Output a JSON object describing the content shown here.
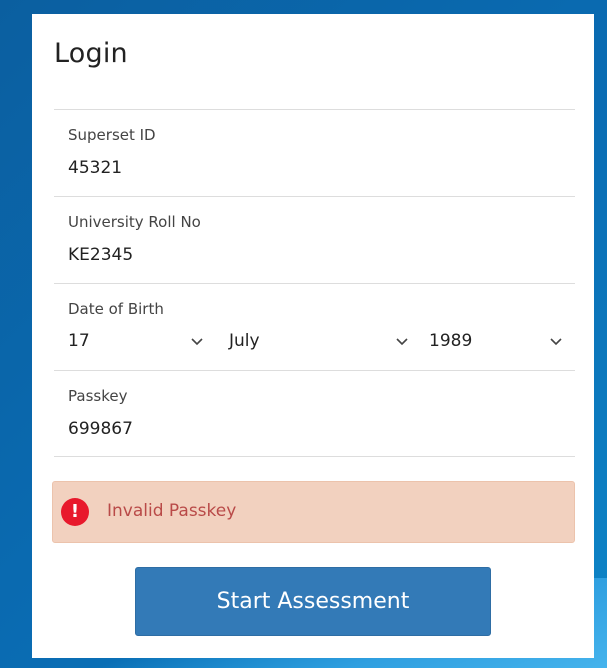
{
  "login": {
    "title": "Login",
    "fields": {
      "superset_id": {
        "label": "Superset ID",
        "value": "45321"
      },
      "roll_no": {
        "label": "University Roll No",
        "value": "KE2345"
      },
      "dob": {
        "label": "Date of Birth",
        "day": "17",
        "month": "July",
        "year": "1989"
      },
      "passkey": {
        "label": "Passkey",
        "value": "699867"
      }
    },
    "alert": {
      "icon": "exclamation-icon",
      "message": "Invalid Passkey",
      "color": "#b94a48",
      "background": "#f2d1bf"
    },
    "submit_label": "Start Assessment"
  },
  "colors": {
    "primary": "#337ab7",
    "background": "#0a6cb3",
    "error_icon": "#e8192c"
  }
}
